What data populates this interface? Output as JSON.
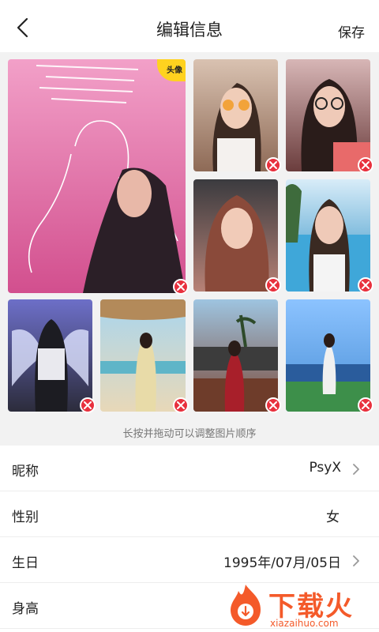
{
  "header": {
    "title": "编辑信息",
    "save_label": "保存"
  },
  "photos": {
    "avatar_badge": "头像",
    "items": [
      {
        "id": "photo-1",
        "color_top": "#f2a0c8",
        "color_bottom": "#d24f8e",
        "is_avatar": true
      },
      {
        "id": "photo-2",
        "color_top": "#d9c2b1",
        "color_bottom": "#8e6a56"
      },
      {
        "id": "photo-3",
        "color_top": "#d7b6b6",
        "color_bottom": "#6b3d3d"
      },
      {
        "id": "photo-4",
        "color_top": "#3b3b3f",
        "color_bottom": "#b88276"
      },
      {
        "id": "photo-5",
        "color_top": "#7cbbe6",
        "color_bottom": "#2b8ec4"
      },
      {
        "id": "photo-6",
        "color_top": "#6d6fc8",
        "color_bottom": "#2c2c3c"
      },
      {
        "id": "photo-7",
        "color_top": "#a9d6ee",
        "color_bottom": "#e8d8b8"
      },
      {
        "id": "photo-8",
        "color_top": "#4a5d6e",
        "color_bottom": "#7d4b3a"
      },
      {
        "id": "photo-9",
        "color_top": "#8cc3ff",
        "color_bottom": "#3d8f4a"
      }
    ],
    "hint": "长按并拖动可以调整图片顺序"
  },
  "profile": {
    "nickname": {
      "label": "昵称",
      "value": "PsyX"
    },
    "gender": {
      "label": "性别",
      "value": "女"
    },
    "birthday": {
      "label": "生日",
      "value": "1995年/07月/05日"
    },
    "height": {
      "label": "身高",
      "value": ""
    }
  },
  "watermark": {
    "brand": "下载火",
    "url": "xiazaihuo.com"
  },
  "colors": {
    "delete": "#e8303d",
    "badge": "#ffd21f",
    "watermark": "#f45a2a"
  }
}
